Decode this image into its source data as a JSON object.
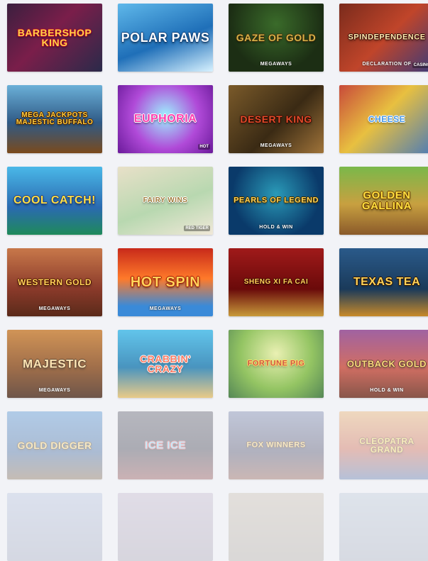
{
  "games": [
    {
      "id": "barbershop-king",
      "title": "Barbershop King",
      "sub": "",
      "badge": "",
      "bg": "linear-gradient(135deg,#3b1f3f,#7a1e4a 45%,#2a2a4a)",
      "color": "#ffd447",
      "size": 14,
      "shadow": "#b0002a"
    },
    {
      "id": "polar-paws",
      "title": "Polar Paws",
      "sub": "",
      "badge": "",
      "bg": "linear-gradient(160deg,#5fb8ea,#1f6fb8 55%,#d8f2ff)",
      "color": "#ffffff",
      "size": 18,
      "shadow": "#0c3f7a"
    },
    {
      "id": "gaze-of-gold",
      "title": "Gaze of Gold",
      "sub": "MegaWays",
      "badge": "",
      "bg": "radial-gradient(circle at 50% 30%,#3a6b2a,#1c2e14 70%)",
      "color": "#d8b24a",
      "size": 14,
      "shadow": "#3a2a08"
    },
    {
      "id": "spindependence",
      "title": "Spindependence",
      "sub": "Declaration of",
      "badge": "Casino",
      "bg": "linear-gradient(135deg,#7a2b1c,#c0452a 50%,#3a3a7a)",
      "color": "#ffe9b0",
      "size": 11,
      "shadow": "#3a0f08"
    },
    {
      "id": "majestic-buffalo",
      "title": "Mega Jackpots Majestic Buffalo",
      "sub": "",
      "badge": "",
      "bg": "linear-gradient(180deg,#6bb0d8,#2f5a86 55%,#7a4a1c)",
      "color": "#ffcf40",
      "size": 10,
      "shadow": "#4a2000"
    },
    {
      "id": "euphoria",
      "title": "Euphoria",
      "sub": "",
      "badge": "Hot",
      "bg": "radial-gradient(circle at 50% 45%,#9df2ff,#b04ad8 55%,#6a1a9a)",
      "color": "#ff3fae",
      "size": 16,
      "shadow": "#ffffff"
    },
    {
      "id": "tarzan-king",
      "title": "Desert King",
      "sub": "MegaWays",
      "badge": "",
      "bg": "linear-gradient(135deg,#7a5a2a,#3a2a14 55%,#a0743a)",
      "color": "#e04a2a",
      "size": 14,
      "shadow": "#2a0a00"
    },
    {
      "id": "cheese",
      "title": "Cheese",
      "sub": "",
      "badge": "",
      "bg": "linear-gradient(135deg,#c84a3a,#e8c040 45%,#4a7ab8)",
      "color": "#4a9ae8",
      "size": 12,
      "shadow": "#ffffff"
    },
    {
      "id": "cool-catch",
      "title": "Cool Catch!",
      "sub": "",
      "badge": "",
      "bg": "linear-gradient(180deg,#4ab8e8,#2a6ab0 60%,#1f8a5a)",
      "color": "#ffe040",
      "size": 16,
      "shadow": "#1a3a8a"
    },
    {
      "id": "fairy-wins",
      "title": "Fairy Wins",
      "sub": "",
      "badge": "Red Tiger",
      "bg": "linear-gradient(160deg,#e8e0c8,#b8d8b0 55%,#f0e8d8)",
      "color": "#a07a3a",
      "size": 10,
      "shadow": "#ffffff"
    },
    {
      "id": "pearls-of-legend",
      "title": "Pearls of Legend",
      "sub": "Hold & Win",
      "badge": "",
      "bg": "radial-gradient(circle at 50% 40%,#2a9ab8,#0a3a6a 70%)",
      "color": "#ffd45a",
      "size": 11,
      "shadow": "#3a2a00"
    },
    {
      "id": "golden-gallina",
      "title": "Golden Gallina",
      "sub": "",
      "badge": "",
      "bg": "linear-gradient(180deg,#7ab84a,#c8a040 55%,#8a5a2a)",
      "color": "#ffe040",
      "size": 15,
      "shadow": "#6a3a00"
    },
    {
      "id": "western-gold",
      "title": "Western Gold",
      "sub": "MegaWays",
      "badge": "",
      "bg": "linear-gradient(180deg,#c8784a,#8a3a2a 60%,#5a2a1a)",
      "color": "#ffd45a",
      "size": 12,
      "shadow": "#4a1000"
    },
    {
      "id": "hot-spin",
      "title": "Hot Spin",
      "sub": "MegaWays",
      "badge": "",
      "bg": "linear-gradient(180deg,#c82a1a,#ff7a2a 45%,#3a8ad8 85%)",
      "color": "#ffd45a",
      "size": 20,
      "shadow": "#a01000"
    },
    {
      "id": "sheng-xi-fa-cai",
      "title": "Sheng Xi Fa Cai",
      "sub": "",
      "badge": "",
      "bg": "linear-gradient(180deg,#a01a1a,#6a0a0a 60%,#c89a3a)",
      "color": "#ffd45a",
      "size": 10,
      "shadow": "#3a0000"
    },
    {
      "id": "texas-tea",
      "title": "Texas Tea",
      "sub": "",
      "badge": "",
      "bg": "linear-gradient(180deg,#2a5a8a,#1a3a5a 60%,#c88a2a)",
      "color": "#ffd45a",
      "size": 16,
      "shadow": "#2a1000"
    },
    {
      "id": "majestic-megaways",
      "title": "Majestic",
      "sub": "MegaWays",
      "badge": "",
      "bg": "linear-gradient(180deg,#c87a2a,#8a4a1a 55%,#4a2a1a)",
      "color": "#ffe0a0",
      "size": 17,
      "shadow": "#3a1a00"
    },
    {
      "id": "crabbin-crazy",
      "title": "Crabbin' Crazy",
      "sub": "",
      "badge": "",
      "bg": "linear-gradient(180deg,#3ab8e8,#1a7ab0 55%,#e8c06a)",
      "color": "#ff5a3a",
      "size": 14,
      "shadow": "#ffffff"
    },
    {
      "id": "fortune-pig",
      "title": "Fortune Pig",
      "sub": "",
      "badge": "",
      "bg": "radial-gradient(circle at 50% 35%,#e8f0a0,#7ab83a 55%,#2a6a2a)",
      "color": "#c82a1a",
      "size": 11,
      "shadow": "#ffe040"
    },
    {
      "id": "outback-gold",
      "title": "Outback Gold",
      "sub": "Hold & Win",
      "badge": "",
      "bg": "linear-gradient(180deg,#8a3a8a,#c84a3a 55%,#6a2a1a)",
      "color": "#ffd45a",
      "size": 13,
      "shadow": "#3a0a00"
    },
    {
      "id": "gold-digger",
      "title": "Gold Digger",
      "sub": "",
      "badge": "",
      "bg": "linear-gradient(180deg,#2a7ac8,#1a4a8a 60%,#6a4a2a)",
      "color": "#ffd45a",
      "size": 14,
      "shadow": "#1a1000"
    },
    {
      "id": "ice-ice",
      "title": "Ice Ice",
      "sub": "",
      "badge": "",
      "bg": "linear-gradient(180deg,#3a3a4a,#1a1a2a 55%,#7a2a2a)",
      "color": "#6ad8ff",
      "size": 15,
      "shadow": "#ff3a3a"
    },
    {
      "id": "fox-wins",
      "title": "Fox Winners",
      "sub": "",
      "badge": "",
      "bg": "linear-gradient(180deg,#5a6a9a,#2a2a4a 60%,#7a3a2a)",
      "color": "#ffd45a",
      "size": 11,
      "shadow": "#2a0a00"
    },
    {
      "id": "cleopatra-grand",
      "title": "Cleopatra Grand",
      "sub": "",
      "badge": "",
      "bg": "linear-gradient(180deg,#e8a04a,#c84a2a 55%,#3a5a9a)",
      "color": "#ffe040",
      "size": 12,
      "shadow": "#6a1a00"
    },
    {
      "id": "row7-a",
      "title": "",
      "sub": "",
      "badge": "",
      "bg": "linear-gradient(180deg,#5a7ab8,#2a3a6a)",
      "color": "#ffffff",
      "size": 10,
      "shadow": "#000000"
    },
    {
      "id": "row7-b",
      "title": "",
      "sub": "",
      "badge": "",
      "bg": "linear-gradient(180deg,#7a5a8a,#3a2a4a)",
      "color": "#ffffff",
      "size": 10,
      "shadow": "#000000"
    },
    {
      "id": "row7-c",
      "title": "",
      "sub": "",
      "badge": "",
      "bg": "linear-gradient(180deg,#8a6a3a,#4a3a1a)",
      "color": "#ffffff",
      "size": 10,
      "shadow": "#000000"
    },
    {
      "id": "row7-d",
      "title": "",
      "sub": "",
      "badge": "",
      "bg": "linear-gradient(180deg,#6a8aa8,#3a4a6a)",
      "color": "#ffffff",
      "size": 10,
      "shadow": "#000000"
    }
  ]
}
